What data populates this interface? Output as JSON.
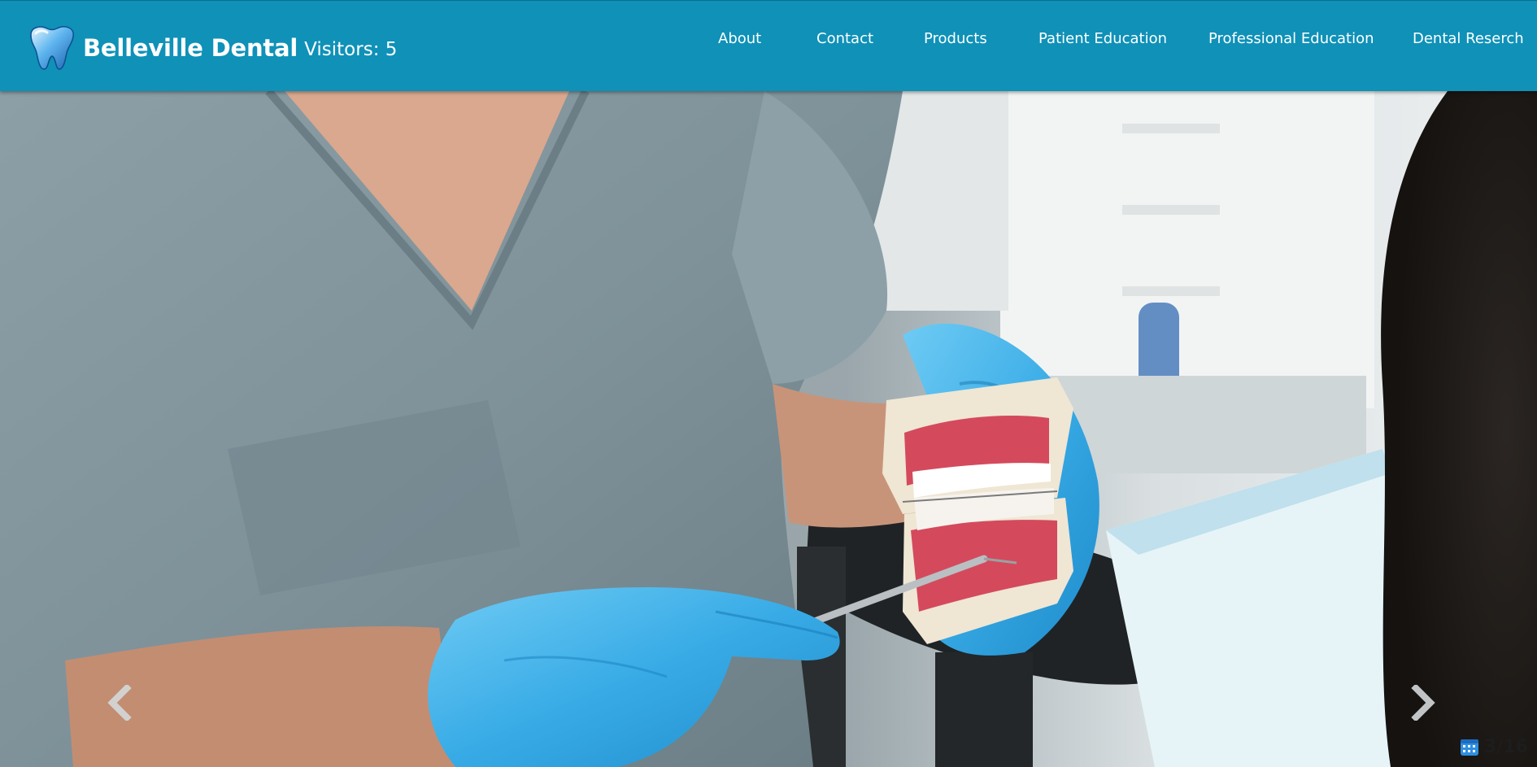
{
  "header": {
    "site_name": "Belleville Dental",
    "visitors": "Visitors: 5",
    "logo_icon": "tooth-icon",
    "background_color": "#0f91b8"
  },
  "nav": {
    "items": [
      {
        "label": "About"
      },
      {
        "label": "Contact"
      },
      {
        "label": "Products"
      },
      {
        "label": "Patient Education"
      },
      {
        "label": "Professional Education"
      },
      {
        "label": "Dental Reserch"
      }
    ]
  },
  "carousel": {
    "prev_icon": "chevron-left-icon",
    "next_icon": "chevron-right-icon",
    "counter_icon": "calendar-icon",
    "counter": "3/16",
    "accent_color": "#2aa7e0"
  }
}
